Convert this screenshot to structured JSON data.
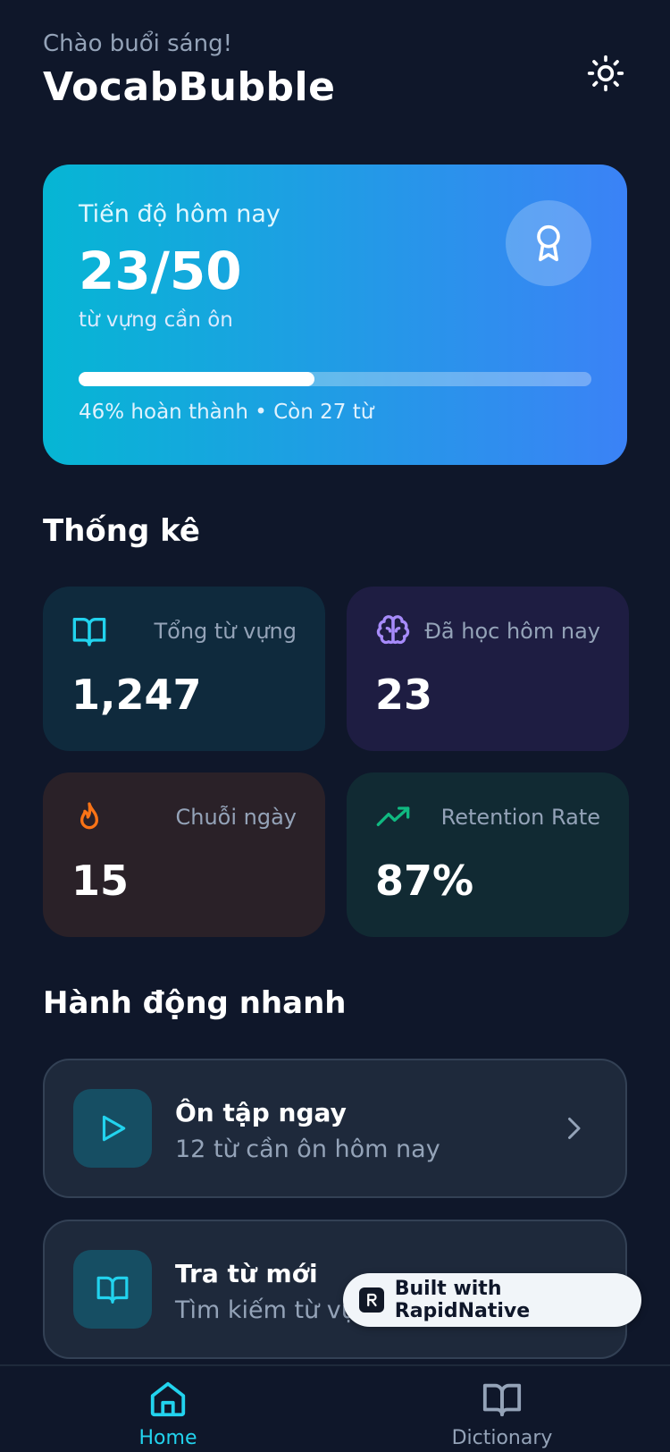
{
  "header": {
    "greeting": "Chào buổi sáng!",
    "title": "VocabBubble",
    "theme_icon": "sun-icon"
  },
  "progress": {
    "label": "Tiến độ hôm nay",
    "value": "23/50",
    "sub": "từ vựng cần ôn",
    "percent_complete": 46,
    "footer": "46% hoàn thành • Còn 27 từ",
    "badge_icon": "award-icon"
  },
  "stats": {
    "title": "Thống kê",
    "items": [
      {
        "label": "Tổng từ vựng",
        "value": "1,247",
        "icon": "book-open-icon",
        "color": "#22d3ee",
        "bg": "#0f2a3d"
      },
      {
        "label": "Đã học hôm nay",
        "value": "23",
        "icon": "brain-icon",
        "color": "#a78bfa",
        "bg": "#1e1d42"
      },
      {
        "label": "Chuỗi ngày",
        "value": "15",
        "icon": "flame-icon",
        "color": "#f97316",
        "bg": "#2a2128"
      },
      {
        "label": "Retention Rate",
        "value": "87%",
        "icon": "trending-up-icon",
        "color": "#10b981",
        "bg": "#112a33"
      }
    ]
  },
  "quick_actions": {
    "title": "Hành động nhanh",
    "items": [
      {
        "title": "Ôn tập ngay",
        "subtitle": "12 từ cần ôn hôm nay",
        "icon": "play-icon"
      },
      {
        "title": "Tra từ mới",
        "subtitle": "Tìm kiếm từ vựng",
        "icon": "book-open-icon"
      }
    ]
  },
  "badge": {
    "text": "Built with RapidNative"
  },
  "tabbar": {
    "tabs": [
      {
        "label": "Home",
        "icon": "home-icon",
        "active": true
      },
      {
        "label": "Dictionary",
        "icon": "book-open-icon",
        "active": false
      }
    ],
    "active_color": "#22d3ee",
    "inactive_color": "#94a3b8"
  }
}
